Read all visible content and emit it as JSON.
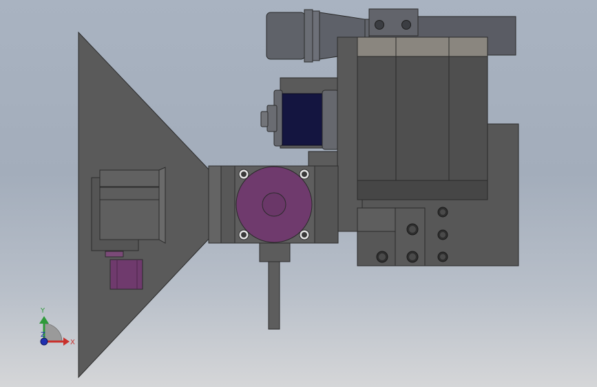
{
  "viewport": {
    "background_top": "#a9b3c1",
    "background_bottom": "#d5d6d8",
    "colors": {
      "part_gray": "#5b5b5b",
      "part_dark": "#4e4e4e",
      "part_light": "#8e8a82",
      "motor_purple": "#6f3a6d",
      "coil_navy": "#141540",
      "cylinder_gray": "#5c5f68"
    }
  },
  "triad": {
    "x_label": "X",
    "y_label": "Y",
    "z_label": "Z",
    "x_color": "#c9302c",
    "y_color": "#2e9a3a",
    "z_color": "#1f2fb0"
  }
}
